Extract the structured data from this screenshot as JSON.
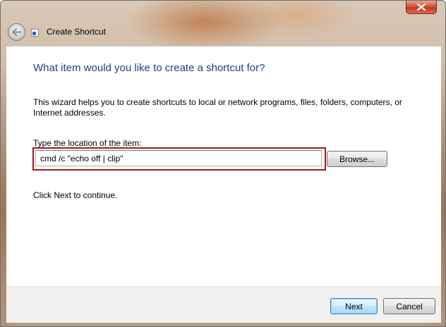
{
  "window": {
    "title": "Create Shortcut"
  },
  "wizard": {
    "heading": "What item would you like to create a shortcut for?",
    "description": "This wizard helps you to create shortcuts to local or network programs, files, folders, computers, or Internet addresses.",
    "location_label": "Type the location of the item:",
    "location_value": "cmd /c \"echo off | clip\"",
    "browse_label": "Browse...",
    "continue_text": "Click Next to continue."
  },
  "footer": {
    "next_label": "Next",
    "cancel_label": "Cancel"
  },
  "colors": {
    "heading": "#1e3f8a",
    "highlight_border": "#a2181b",
    "close_button": "#c8472f"
  },
  "icons": [
    "close-icon",
    "back-arrow-icon",
    "shortcut-icon"
  ]
}
